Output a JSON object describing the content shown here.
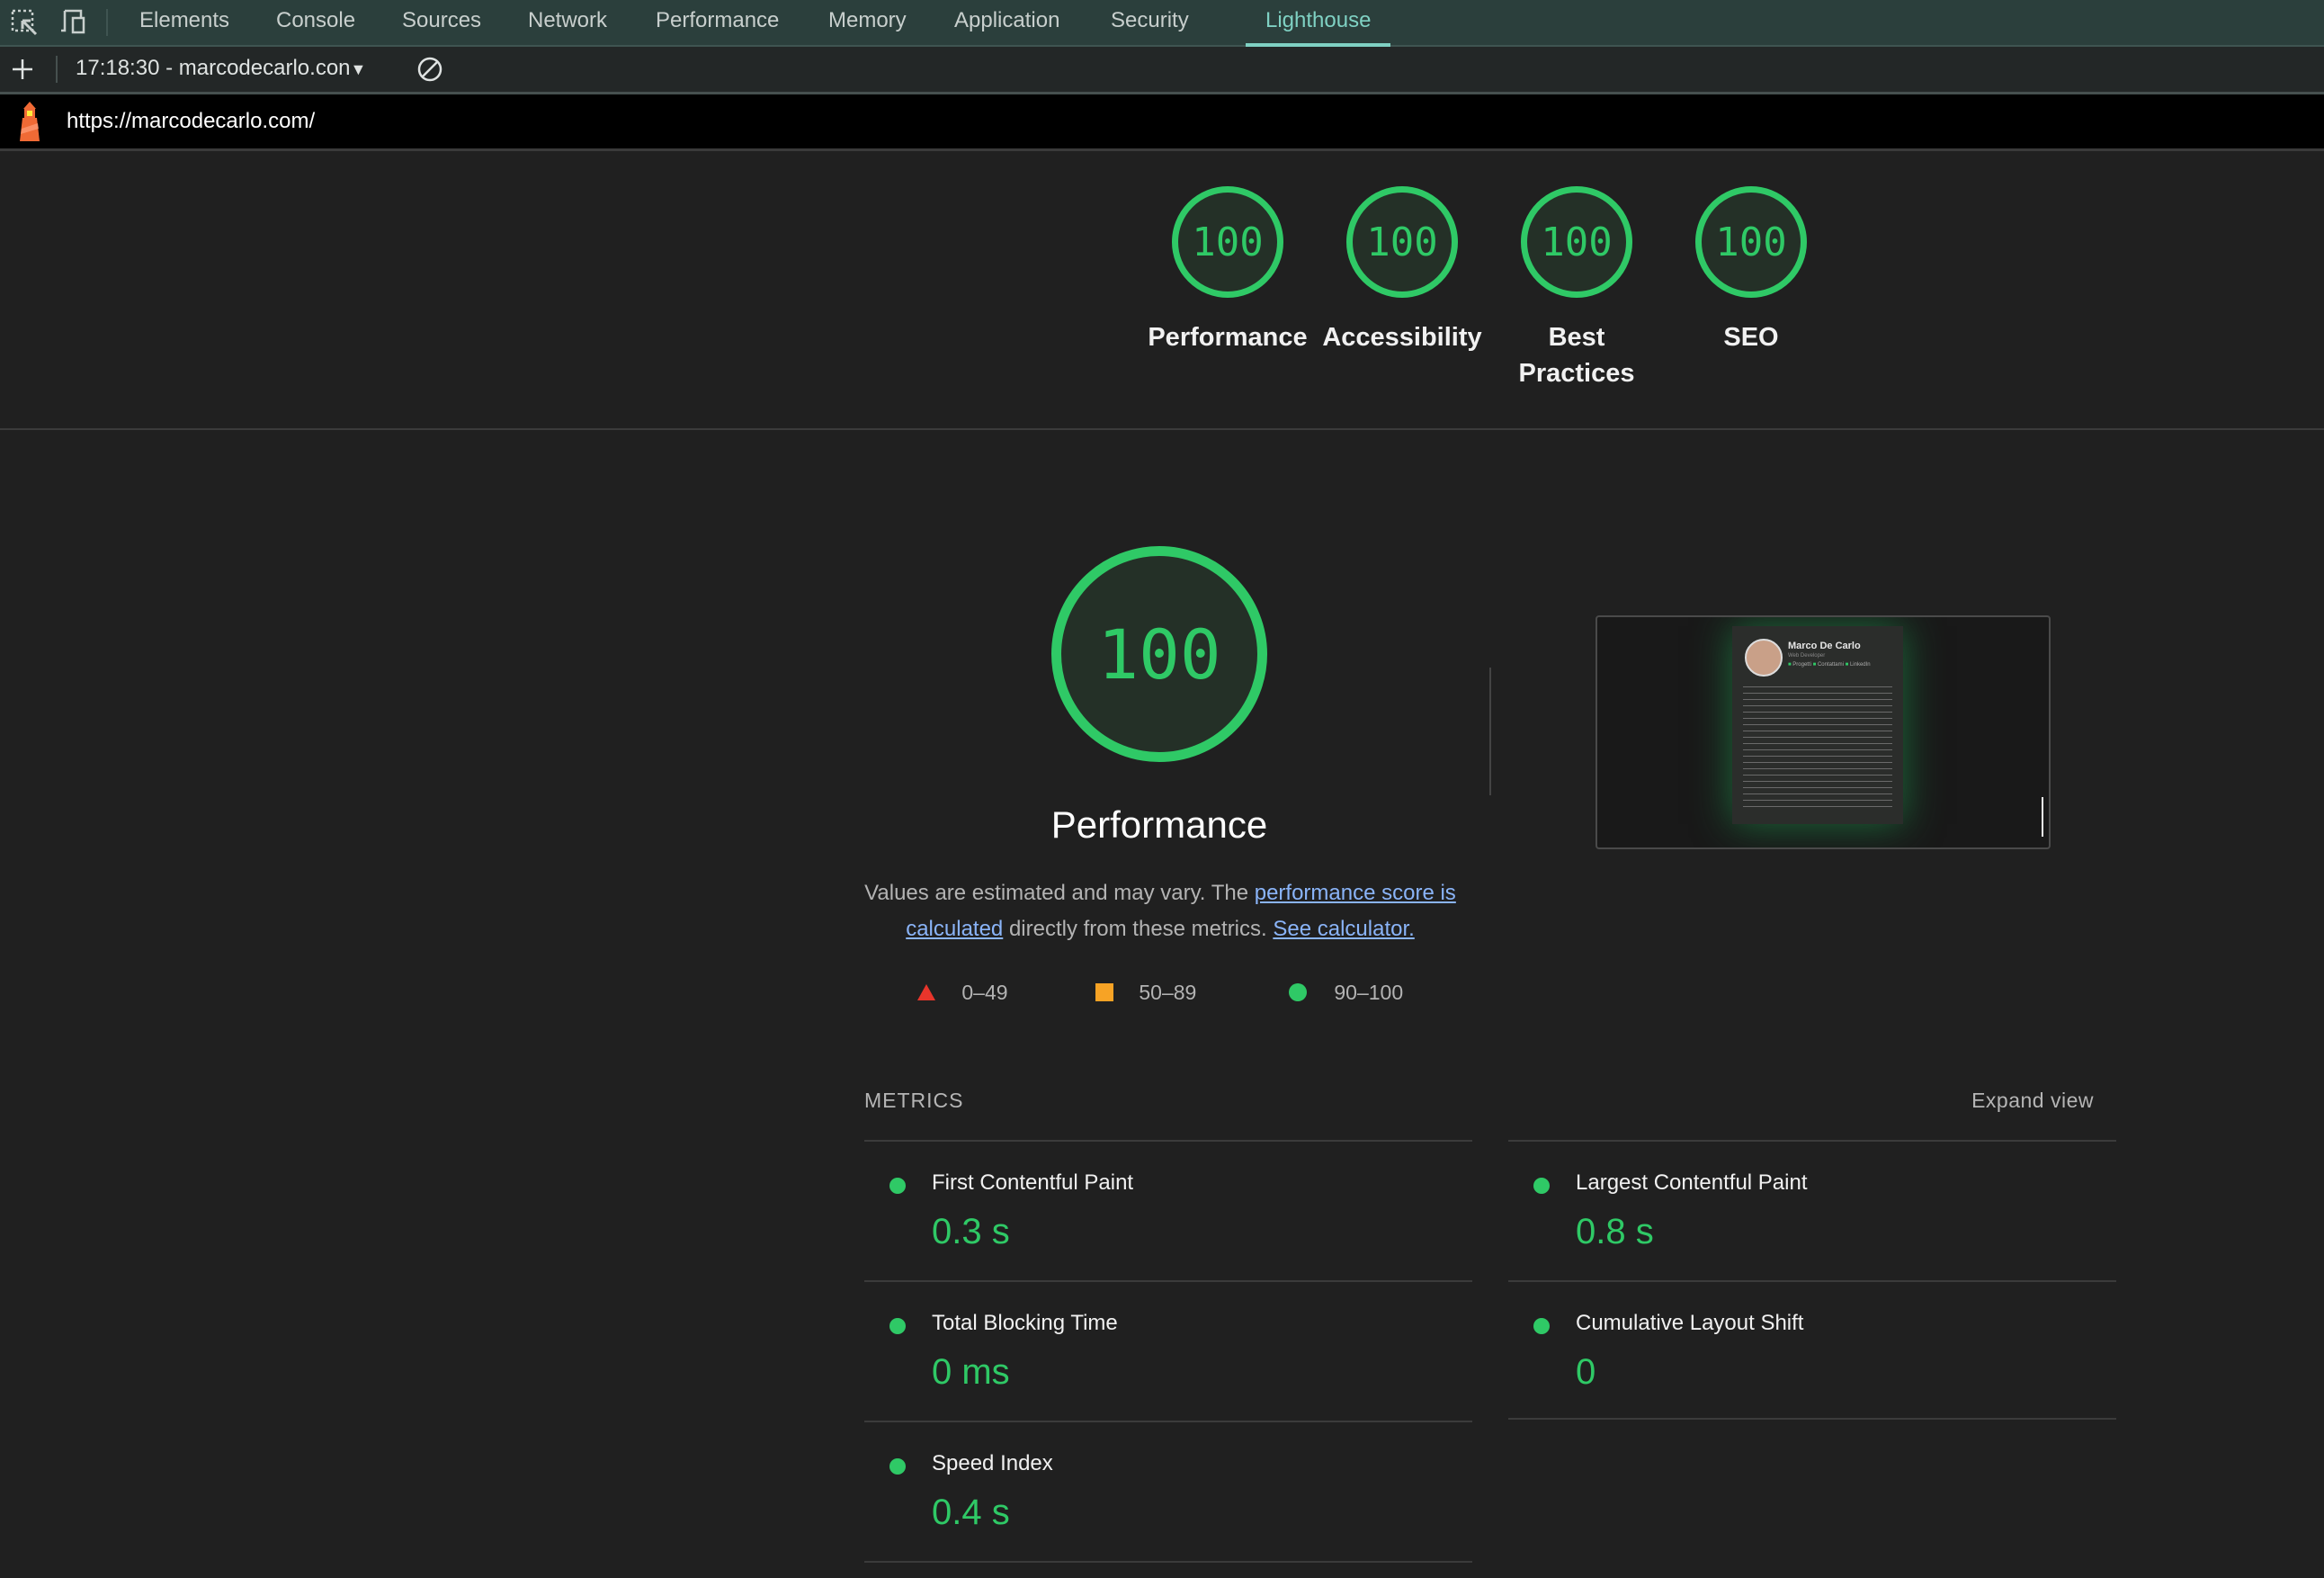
{
  "devtools": {
    "tabs": [
      {
        "label": "Elements"
      },
      {
        "label": "Console"
      },
      {
        "label": "Sources"
      },
      {
        "label": "Network"
      },
      {
        "label": "Performance"
      },
      {
        "label": "Memory"
      },
      {
        "label": "Application"
      },
      {
        "label": "Security"
      },
      {
        "label": "Lighthouse",
        "active": true
      }
    ],
    "report_selector": "17:18:30 - marcodecarlo.con"
  },
  "report": {
    "url": "https://marcodecarlo.com/",
    "summary_scores": [
      {
        "label": "Performance",
        "score": "100"
      },
      {
        "label": "Accessibility",
        "score": "100"
      },
      {
        "label": "Best Practices",
        "score": "100"
      },
      {
        "label": "SEO",
        "score": "100"
      }
    ],
    "performance": {
      "score": "100",
      "title": "Performance",
      "desc_prefix": "Values are estimated and may vary. The ",
      "desc_link1": "performance score is calculated",
      "desc_middle": " directly from these metrics. ",
      "desc_link2": "See calculator.",
      "legend": [
        {
          "range": "0–49",
          "shape": "triangle",
          "color": "#e8352b"
        },
        {
          "range": "50–89",
          "shape": "square",
          "color": "#f7a325"
        },
        {
          "range": "90–100",
          "shape": "circle",
          "color": "#2fc966"
        }
      ],
      "screenshot": {
        "name": "Marco De Carlo",
        "subtitle": "Web Developer",
        "links": [
          "Progetti",
          "Contattami",
          "LinkedIn"
        ]
      }
    },
    "metrics": {
      "heading": "METRICS",
      "expand_label": "Expand view",
      "items": [
        {
          "name": "First Contentful Paint",
          "value": "0.3 s"
        },
        {
          "name": "Largest Contentful Paint",
          "value": "0.8 s"
        },
        {
          "name": "Total Blocking Time",
          "value": "0 ms"
        },
        {
          "name": "Cumulative Layout Shift",
          "value": "0"
        },
        {
          "name": "Speed Index",
          "value": "0.4 s"
        }
      ]
    }
  },
  "colors": {
    "pass": "#2fc966",
    "accent": "#7fd1c3",
    "link": "#8ab4f8"
  }
}
